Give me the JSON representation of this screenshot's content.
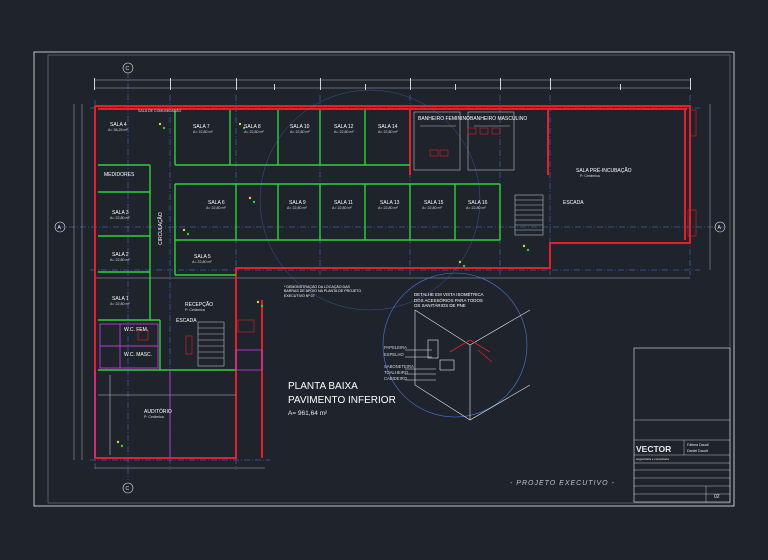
{
  "drawing": {
    "title_line1": "PLANTA BAIXA",
    "title_line2": "PAVIMENTO INFERIOR",
    "area": "A= 961,64 m²",
    "stage": "- PROJETO  EXECUTIVO -",
    "sheet_number": "02",
    "section_a": "A",
    "section_c": "C",
    "accessible_note": "* DEMONSTRAÇÃO DA LOCAÇÃO DAS BARRAS DE APOIO NA PLANTA DE PROJETO EXECUTIVO Nº 07",
    "detail_title": "DETALHE EM VISTA ISOMÉTRICA DOS ACESSÓRIOS PARA TODOS OS SANITÁRIOS DE PNE",
    "detail_labels": [
      "PAPELEIRA",
      "ESPELHO",
      "SABONETEIRA",
      "TOALHEIRO",
      "CABIDEIRO"
    ]
  },
  "rooms": {
    "sala4": "SALA 4",
    "sala4_area": "A= 36,25 m²",
    "comunicacao": "SALA DE COMUNICAÇÃO",
    "sala7": "SALA 7",
    "sala8": "SALA 8",
    "sala10": "SALA 10",
    "sala12": "SALA 12",
    "sala14": "SALA 14",
    "banheiro_fem": "BANHEIRO FEMININO",
    "banheiro_masc": "BANHEIRO MASCULINO",
    "medidores": "MEDIDORES",
    "sala3": "SALA 3",
    "sala2": "SALA 2",
    "sala1": "SALA 1",
    "sala5": "SALA 5",
    "sala6": "SALA 6",
    "sala9": "SALA 9",
    "sala11": "SALA 11",
    "sala13": "SALA 13",
    "sala15": "SALA 15",
    "sala16": "SALA 16",
    "circulacao": "CIRCULAÇÃO",
    "sala_pre": "SALA PRÉ-INCUBAÇÃO",
    "escada": "ESCADA",
    "recepcao": "RECEPÇÃO",
    "wc_fem": "W.C. FEM.",
    "wc_masc": "W.C. MASC.",
    "auditorio": "AUDITÓRIO",
    "sub_area": "A= 22,80 m²",
    "sub_finish": "P: Cerâmica"
  },
  "title_block": {
    "name1": "Fátima Daudt",
    "name2": "Daniel Daudt",
    "company": "VECTOR",
    "company_sub": "engenharia e consultoria"
  },
  "colors": {
    "background": "#1f232b",
    "wall_red": "#e0202a",
    "partition_green": "#2fd13a",
    "grid_blue": "#4a78e8",
    "frame_white": "#e8e8e8",
    "magenta": "#c23ad6"
  }
}
